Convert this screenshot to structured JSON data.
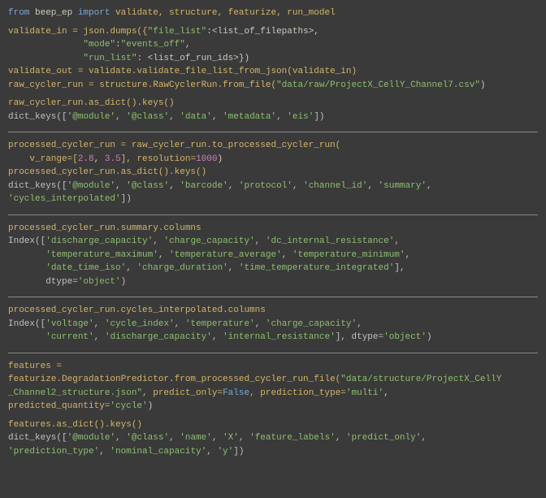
{
  "s1": {
    "l1a": "from",
    "l1b": " beep_ep ",
    "l1c": "import",
    "l1d": " validate, structure, featurize, run_model",
    "l2a": "validate_in = json.dumps({",
    "l2b": "\"file_list\"",
    "l2c": ":<list_of_filepaths>,",
    "l3a": "              ",
    "l3b": "\"mode\"",
    "l3c": ":",
    "l3d": "\"events_off\"",
    "l3e": ",",
    "l4a": "              ",
    "l4b": "\"run_list\"",
    "l4c": ": <list_of_run_ids>})",
    "l5": "validate_out = validate.validate_file_list_from_json(validate_in)",
    "l6a": "raw_cycler_run = structure.RawCyclerRun.from_file(",
    "l6b": "\"data/raw/ProjectX_CellY_Channel7.csv\"",
    "l6c": ")",
    "l7": "raw_cycler_run.as_dict().keys()",
    "l8a": "dict_keys([",
    "l8b": "'@module'",
    "l8c": ", ",
    "l8d": "'@class'",
    "l8e": ", ",
    "l8f": "'data'",
    "l8g": ", ",
    "l8h": "'metadata'",
    "l8i": ", ",
    "l8j": "'eis'",
    "l8k": "])"
  },
  "s2": {
    "l1": "processed_cycler_run = raw_cycler_run.to_processed_cycler_run(",
    "l2a": "    v_range=[",
    "l2b": "2.8",
    "l2c": ", ",
    "l2d": "3.5",
    "l2e": "], resolution=",
    "l2f": "1000",
    "l2g": ")",
    "l3": "processed_cycler_run.as_dict().keys()",
    "l4a": "dict_keys([",
    "l4b": "'@module'",
    "l4c": ", ",
    "l4d": "'@class'",
    "l4e": ", ",
    "l4f": "'barcode'",
    "l4g": ", ",
    "l4h": "'protocol'",
    "l4i": ", ",
    "l4j": "'channel_id'",
    "l4k": ", ",
    "l4l": "'summary'",
    "l4m": ",",
    "l5a": "'cycles_interpolated'",
    "l5b": "])"
  },
  "s3": {
    "l1": "processed_cycler_run.summary.columns",
    "l2a": "Index([",
    "l2b": "'discharge_capacity'",
    "l2c": ", ",
    "l2d": "'charge_capacity'",
    "l2e": ", ",
    "l2f": "'dc_internal_resistance'",
    "l2g": ",",
    "l3a": "       ",
    "l3b": "'temperature_maximum'",
    "l3c": ", ",
    "l3d": "'temperature_average'",
    "l3e": ", ",
    "l3f": "'temperature_minimum'",
    "l3g": ",",
    "l4a": "       ",
    "l4b": "'date_time_iso'",
    "l4c": ", ",
    "l4d": "'charge_duration'",
    "l4e": ", ",
    "l4f": "'time_temperature_integrated'",
    "l4g": "],",
    "l5a": "       dtype=",
    "l5b": "'object'",
    "l5c": ")"
  },
  "s4": {
    "l1": "processed_cycler_run.cycles_interpolated.columns",
    "l2a": "Index([",
    "l2b": "'voltage'",
    "l2c": ", ",
    "l2d": "'cycle_index'",
    "l2e": ", ",
    "l2f": "'temperature'",
    "l2g": ", ",
    "l2h": "'charge_capacity'",
    "l2i": ",",
    "l3a": "       ",
    "l3b": "'current'",
    "l3c": ", ",
    "l3d": "'discharge_capacity'",
    "l3e": ", ",
    "l3f": "'internal_resistance'",
    "l3g": "], dtype=",
    "l3h": "'object'",
    "l3i": ")"
  },
  "s5": {
    "l1": "features =",
    "l2a": "featurize.DegradationPredictor.from_processed_cycler_run_file(",
    "l2b": "\"data/structure/ProjectX_CellY",
    "l3a": "_Channel2_structure.json\"",
    "l3b": ", predict_only=",
    "l3c": "False",
    "l3d": ", prediction_type=",
    "l3e": "'multi'",
    "l3f": ",",
    "l4a": "predicted_quantity=",
    "l4b": "'cycle'",
    "l4c": ")",
    "l5": "features.as_dict().keys()",
    "l6a": "dict_keys([",
    "l6b": "'@module'",
    "l6c": ", ",
    "l6d": "'@class'",
    "l6e": ", ",
    "l6f": "'name'",
    "l6g": ", ",
    "l6h": "'X'",
    "l6i": ", ",
    "l6j": "'feature_labels'",
    "l6k": ", ",
    "l6l": "'predict_only'",
    "l6m": ",",
    "l7a": "'prediction_type'",
    "l7b": ", ",
    "l7c": "'nominal_capacity'",
    "l7d": ", ",
    "l7e": "'y'",
    "l7f": "])"
  }
}
